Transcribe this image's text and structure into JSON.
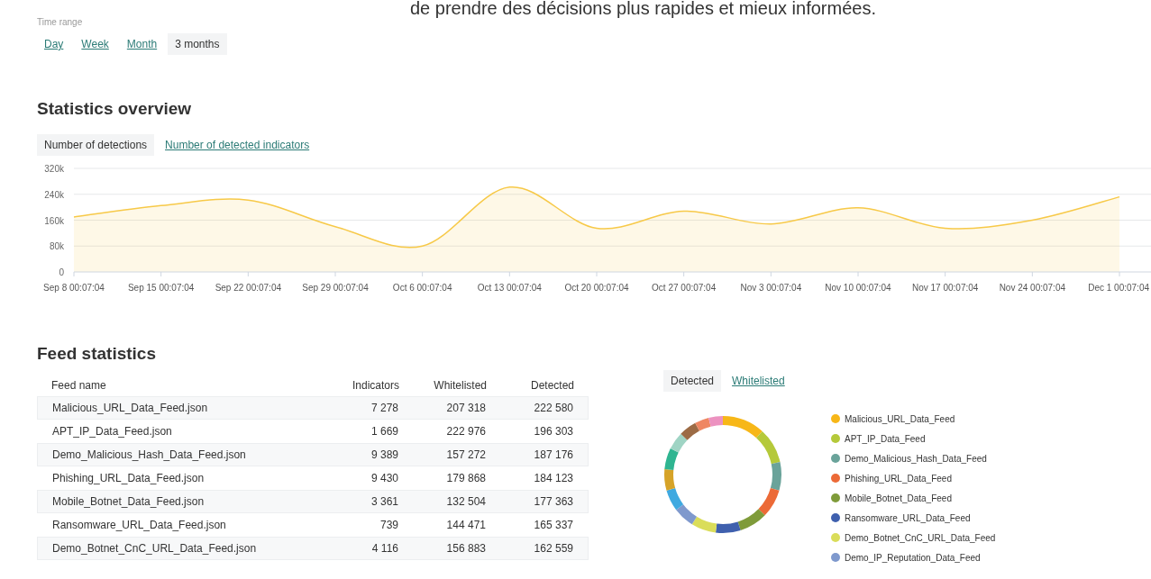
{
  "header_text": "de prendre des décisions plus rapides et mieux informées.",
  "time_range": {
    "label": "Time range",
    "options": [
      {
        "label": "Day",
        "selected": false
      },
      {
        "label": "Week",
        "selected": false
      },
      {
        "label": "Month",
        "selected": false
      },
      {
        "label": "3 months",
        "selected": true
      }
    ]
  },
  "statistics_overview": {
    "title": "Statistics overview",
    "tabs": [
      {
        "label": "Number of detections",
        "selected": true
      },
      {
        "label": "Number of detected indicators",
        "selected": false
      }
    ],
    "chart_data": {
      "type": "area",
      "categories": [
        "Sep 8 00:07:04",
        "Sep 15 00:07:04",
        "Sep 22 00:07:04",
        "Sep 29 00:07:04",
        "Oct 6 00:07:04",
        "Oct 13 00:07:04",
        "Oct 20 00:07:04",
        "Oct 27 00:07:04",
        "Nov 3 00:07:04",
        "Nov 10 00:07:04",
        "Nov 17 00:07:04",
        "Nov 24 00:07:04",
        "Dec 1 00:07:04"
      ],
      "grid": true,
      "series": [
        {
          "color": "#f7c948",
          "values": [
            170000,
            205000,
            222000,
            140000,
            80000,
            262000,
            135000,
            188000,
            148000,
            198000,
            135000,
            160000,
            232000
          ]
        }
      ],
      "ylim": [
        0,
        320000
      ],
      "yticks": [
        {
          "value": 0,
          "label": "0"
        },
        {
          "value": 80000,
          "label": "80k"
        },
        {
          "value": 160000,
          "label": "160k"
        },
        {
          "value": 240000,
          "label": "240k"
        },
        {
          "value": 320000,
          "label": "320k"
        }
      ]
    }
  },
  "feed_statistics": {
    "title": "Feed statistics",
    "table": {
      "columns": [
        "Feed name",
        "Indicators",
        "Whitelisted",
        "Detected"
      ],
      "rows": [
        [
          "Malicious_URL_Data_Feed.json",
          "7 278",
          "207 318",
          "222 580"
        ],
        [
          "APT_IP_Data_Feed.json",
          "1 669",
          "222 976",
          "196 303"
        ],
        [
          "Demo_Malicious_Hash_Data_Feed.json",
          "9 389",
          "157 272",
          "187 176"
        ],
        [
          "Phishing_URL_Data_Feed.json",
          "9 430",
          "179 868",
          "184 123"
        ],
        [
          "Mobile_Botnet_Data_Feed.json",
          "3 361",
          "132 504",
          "177 363"
        ],
        [
          "Ransomware_URL_Data_Feed.json",
          "739",
          "144 471",
          "165 337"
        ],
        [
          "Demo_Botnet_CnC_URL_Data_Feed.json",
          "4 116",
          "156 883",
          "162 559"
        ]
      ]
    },
    "donut_tabs": [
      {
        "label": "Detected",
        "selected": true
      },
      {
        "label": "Whitelisted",
        "selected": false
      }
    ],
    "legend": [
      {
        "label": "Malicious_URL_Data_Feed",
        "color": "#f7b718"
      },
      {
        "label": "APT_IP_Data_Feed",
        "color": "#b5c93a"
      },
      {
        "label": "Demo_Malicious_Hash_Data_Feed",
        "color": "#6aa39a"
      },
      {
        "label": "Phishing_URL_Data_Feed",
        "color": "#ec6a37"
      },
      {
        "label": "Mobile_Botnet_Data_Feed",
        "color": "#7f9b3a"
      },
      {
        "label": "Ransomware_URL_Data_Feed",
        "color": "#3f60ae"
      },
      {
        "label": "Demo_Botnet_CnC_URL_Data_Feed",
        "color": "#dadd5a"
      },
      {
        "label": "Demo_IP_Reputation_Data_Feed",
        "color": "#7f99cd"
      }
    ]
  }
}
